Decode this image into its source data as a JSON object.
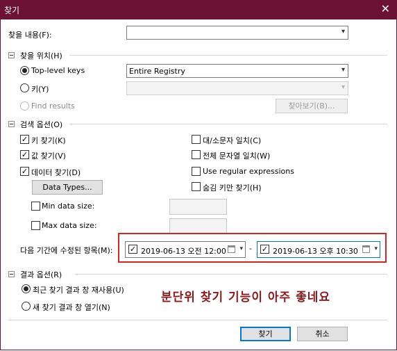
{
  "window": {
    "title": "찾기",
    "close_symbol": "✕"
  },
  "find_what": {
    "label": "찾을 내용(F):",
    "value": ""
  },
  "look_in": {
    "header": "찾을 위치(H)",
    "top_level_label": "Top-level keys",
    "top_level_value": "Entire Registry",
    "key_label": "키(Y)",
    "key_value": "",
    "find_results_label": "Find results",
    "browse_label": "찾아보기(B)..."
  },
  "search_options": {
    "header": "검색 옵션(O)",
    "find_keys": "키 찾기(K)",
    "find_values": "값 찾기(V)",
    "find_data": "데이터 찾기(D)",
    "match_case": "대/소문자 일치(C)",
    "match_whole": "전체 문자열 일치(W)",
    "use_regex": "Use regular expressions",
    "find_hidden": "숨김 키만 찾기(H)",
    "data_types_button": "Data Types...",
    "min_data_size": "Min data size:",
    "max_data_size": "Max data size:",
    "modified_label": "다음 기간에 수정된 항목(M):",
    "date_from": "2019-06-13 오전 12:00",
    "date_separator": "-",
    "date_to": "2019-06-13 오후 10:30",
    "check_mark": "✓"
  },
  "result_options": {
    "header": "결과 옵션(R)",
    "reuse_recent": "최근 찾기 결과 창 재사용(U)",
    "open_new": "새 찾기 결과 창 열기(N)"
  },
  "annotation": "분단위 찾기 기능이 아주 좋네요",
  "buttons": {
    "find": "찾기",
    "cancel": "취소"
  },
  "icons": {
    "dropdown": "chevron-down-icon",
    "calendar": "calendar-icon"
  }
}
